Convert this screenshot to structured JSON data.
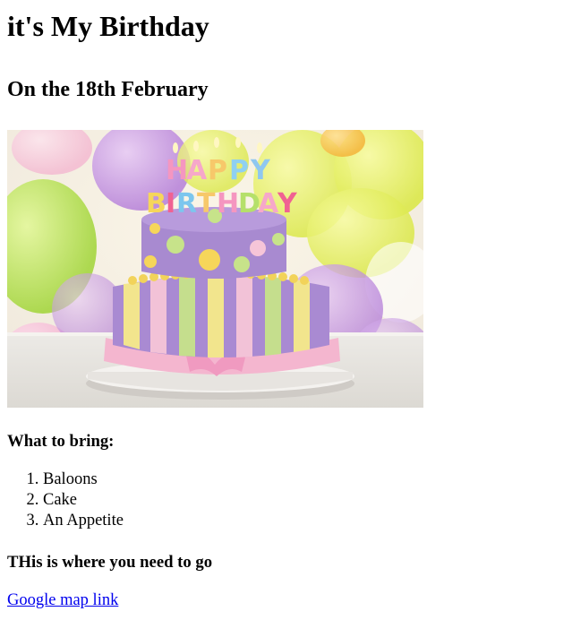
{
  "page": {
    "title": "it's My Birthday",
    "subtitle": "On the 18th February"
  },
  "image": {
    "subject": "birthday-cake-photo",
    "cake_lettering": "HAPPY BIRTHDAY"
  },
  "bring": {
    "heading": "What to bring:",
    "items": [
      "Baloons",
      "Cake",
      "An Appetite"
    ]
  },
  "directions": {
    "heading": "THis is where you need to go",
    "link_text": "Google map link"
  },
  "colors": {
    "link": "#0000ee",
    "text": "#000000",
    "background": "#ffffff"
  }
}
